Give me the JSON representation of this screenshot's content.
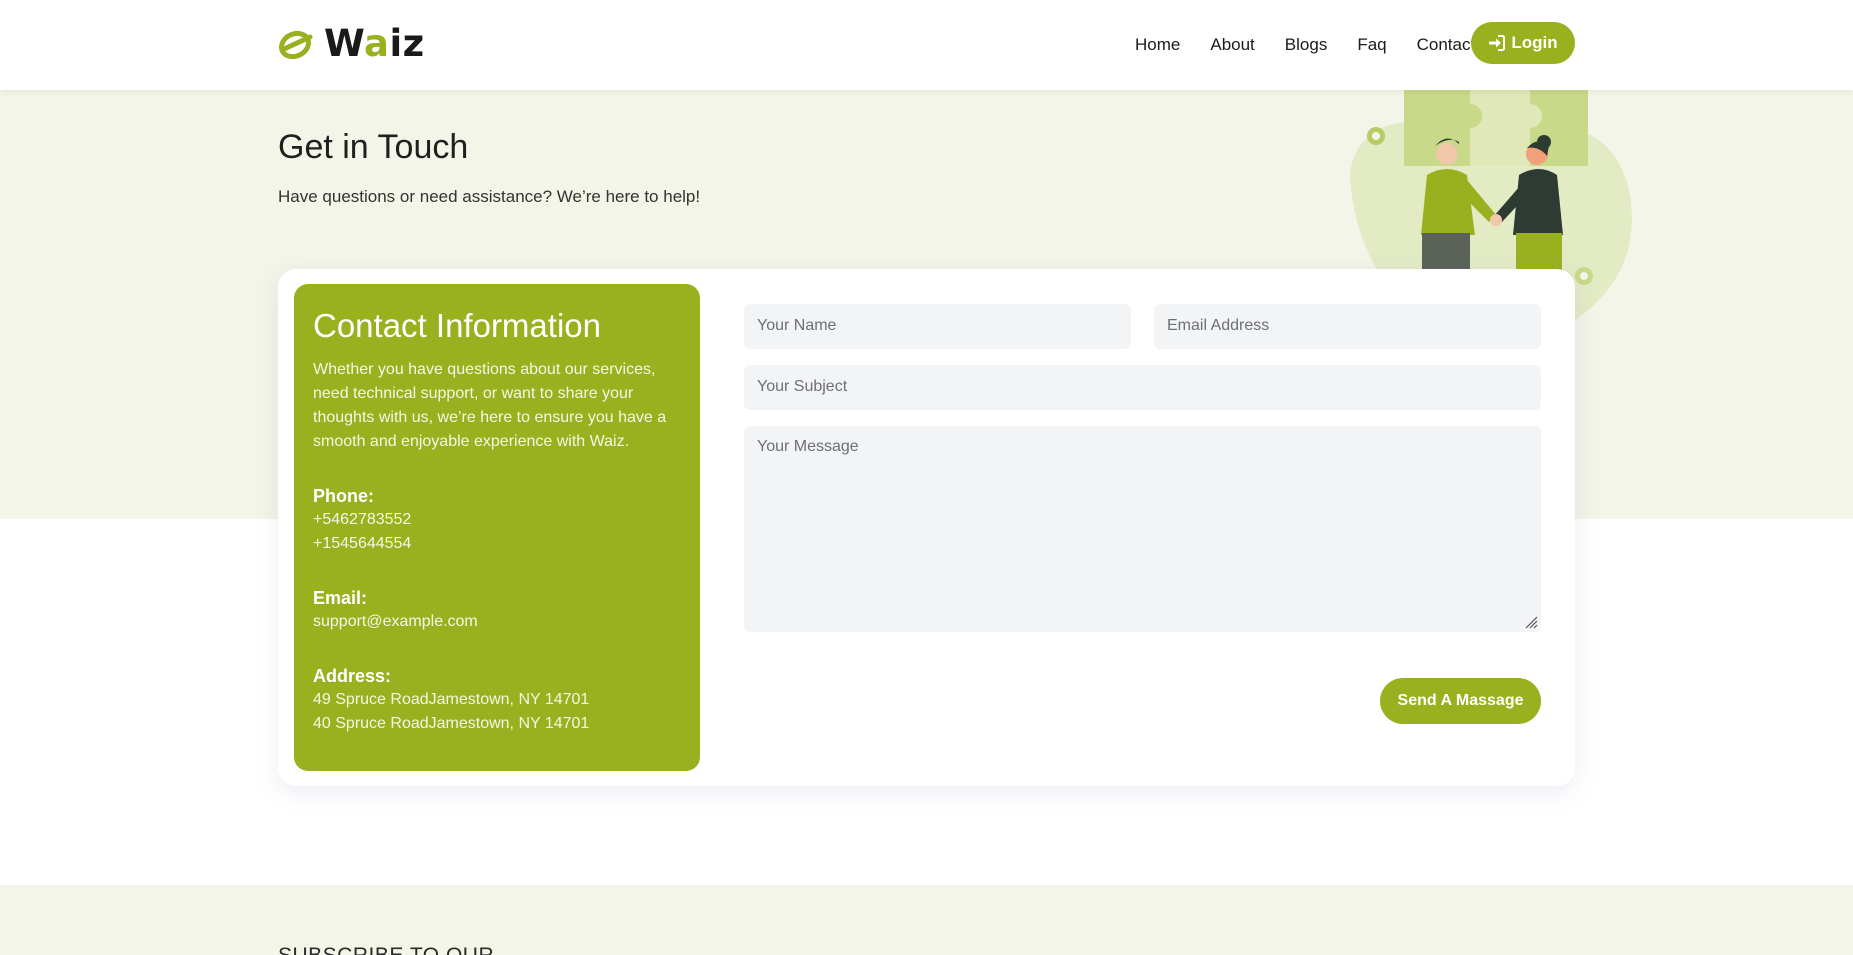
{
  "brand": {
    "name_prefix": "W",
    "name_accent": "a",
    "name_suffix": "iz",
    "color": "#99b11f"
  },
  "nav": {
    "items": [
      "Home",
      "About",
      "Blogs",
      "Faq",
      "Contact"
    ],
    "login_label": "Login"
  },
  "hero": {
    "title": "Get in Touch",
    "subtitle": "Have questions or need assistance? We’re here to help!"
  },
  "contact_info": {
    "title": "Contact Information",
    "description": "Whether you have questions about our services, need technical support, or want to share your thoughts with us, we’re here to ensure you have a smooth and enjoyable experience with Waiz.",
    "phone_label": "Phone:",
    "phones": [
      "+5462783552",
      "+1545644554"
    ],
    "email_label": "Email:",
    "email": "support@example.com",
    "address_label": "Address:",
    "addresses": [
      "49 Spruce RoadJamestown, NY 14701",
      "40 Spruce RoadJamestown, NY 14701"
    ]
  },
  "form": {
    "name_placeholder": "Your Name",
    "email_placeholder": "Email Address",
    "subject_placeholder": "Your Subject",
    "message_placeholder": "Your Message",
    "submit_label": "Send A Massage"
  },
  "footer": {
    "heading": "SUBSCRIBE TO OUR"
  },
  "icons": {
    "login": "sign-in-icon",
    "logo": "logo-mark-icon",
    "resize": "resize-grip-icon"
  }
}
